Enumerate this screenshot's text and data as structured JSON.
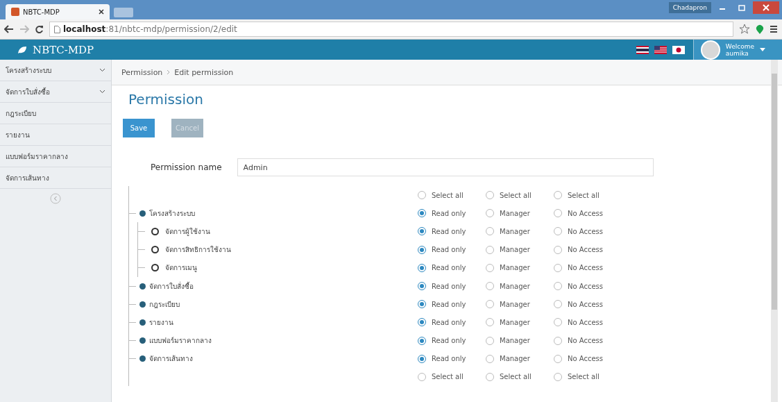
{
  "browser": {
    "tab_title": "NBTC-MDP",
    "profile": "Chadapron",
    "address": "**localhost**:81/nbtc-mdp/permission/2/edit"
  },
  "header": {
    "brand": "NBTC-MDP",
    "welcome": "Welcome",
    "user": "aumika"
  },
  "sidebar": {
    "items": [
      {
        "label": "โครงสร้างระบบ",
        "has_submenu": true
      },
      {
        "label": "จัดการใบสั่งซื้อ",
        "has_submenu": true
      },
      {
        "label": "กฎระเบียบ",
        "has_submenu": false
      },
      {
        "label": "รายงาน",
        "has_submenu": false
      },
      {
        "label": "แบบฟอร์มราคากลาง",
        "has_submenu": false
      },
      {
        "label": "จัดการเส้นทาง",
        "has_submenu": false
      }
    ]
  },
  "breadcrumb": [
    "Permission",
    "Edit permission"
  ],
  "title": "Permission",
  "buttons": [
    {
      "label": "Save",
      "disabled": false
    },
    {
      "label": "Cancel",
      "disabled": true
    }
  ],
  "name_field": {
    "label": "Permission name",
    "value": "Admin"
  },
  "select_all_top": [
    {
      "label": "Select all",
      "selected": false
    },
    {
      "label": "Select all",
      "selected": false
    },
    {
      "label": "Select all",
      "selected": false
    }
  ],
  "tree": [
    {
      "label": "โครงสร้างระบบ",
      "options": [
        {
          "label": "Read only",
          "selected": true
        },
        {
          "label": "Manager",
          "selected": false
        },
        {
          "label": "No Access",
          "selected": false
        }
      ],
      "children": [
        {
          "label": "จัดการผู้ใช้งาน",
          "options": [
            {
              "label": "Read only",
              "selected": true
            },
            {
              "label": "Manager",
              "selected": false
            },
            {
              "label": "No Access",
              "selected": false
            }
          ]
        },
        {
          "label": "จัดการสิทธิการใช้งาน",
          "options": [
            {
              "label": "Read only",
              "selected": true
            },
            {
              "label": "Manager",
              "selected": false
            },
            {
              "label": "No Access",
              "selected": false
            }
          ]
        },
        {
          "label": "จัดการเมนู",
          "options": [
            {
              "label": "Read only",
              "selected": true
            },
            {
              "label": "Manager",
              "selected": false
            },
            {
              "label": "No Access",
              "selected": false
            }
          ]
        }
      ]
    },
    {
      "label": "จัดการใบสั่งซื้อ",
      "options": [
        {
          "label": "Read only",
          "selected": true
        },
        {
          "label": "Manager",
          "selected": false
        },
        {
          "label": "No Access",
          "selected": false
        }
      ]
    },
    {
      "label": "กฎระเบียบ",
      "options": [
        {
          "label": "Read only",
          "selected": true
        },
        {
          "label": "Manager",
          "selected": false
        },
        {
          "label": "No Access",
          "selected": false
        }
      ]
    },
    {
      "label": "รายงาน",
      "options": [
        {
          "label": "Read only",
          "selected": true
        },
        {
          "label": "Manager",
          "selected": false
        },
        {
          "label": "No Access",
          "selected": false
        }
      ]
    },
    {
      "label": "แบบฟอร์มราคากลาง",
      "options": [
        {
          "label": "Read only",
          "selected": true
        },
        {
          "label": "Manager",
          "selected": false
        },
        {
          "label": "No Access",
          "selected": false
        }
      ]
    },
    {
      "label": "จัดการเส้นทาง",
      "options": [
        {
          "label": "Read only",
          "selected": true
        },
        {
          "label": "Manager",
          "selected": false
        },
        {
          "label": "No Access",
          "selected": false
        }
      ]
    }
  ],
  "select_all_bottom": [
    {
      "label": "Select all",
      "selected": false
    },
    {
      "label": "Select all",
      "selected": false
    },
    {
      "label": "Select all",
      "selected": false
    }
  ]
}
